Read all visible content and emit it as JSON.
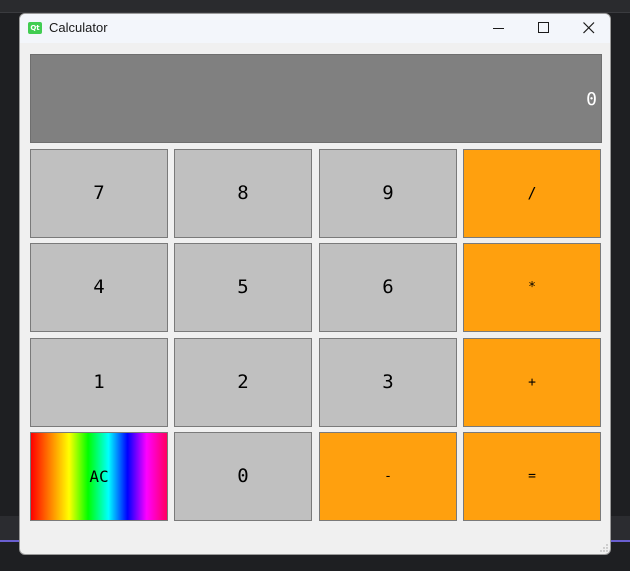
{
  "window": {
    "title": "Calculator",
    "icon_text": "Qt",
    "controls": [
      "minimize-icon",
      "maximize-icon",
      "close-icon"
    ]
  },
  "display": {
    "value": "0"
  },
  "keys": {
    "seven": "7",
    "eight": "8",
    "nine": "9",
    "divide": "/",
    "four": "4",
    "five": "5",
    "six": "6",
    "multiply": "*",
    "one": "1",
    "two": "2",
    "three": "3",
    "add": "+",
    "clear": "AC",
    "zero": "0",
    "subtract": "-",
    "equals": "="
  },
  "colors": {
    "digit_key": "#c0c0c0",
    "operator_key": "#ffa00e",
    "display_bg": "#808080",
    "display_text": "#ffffff"
  }
}
